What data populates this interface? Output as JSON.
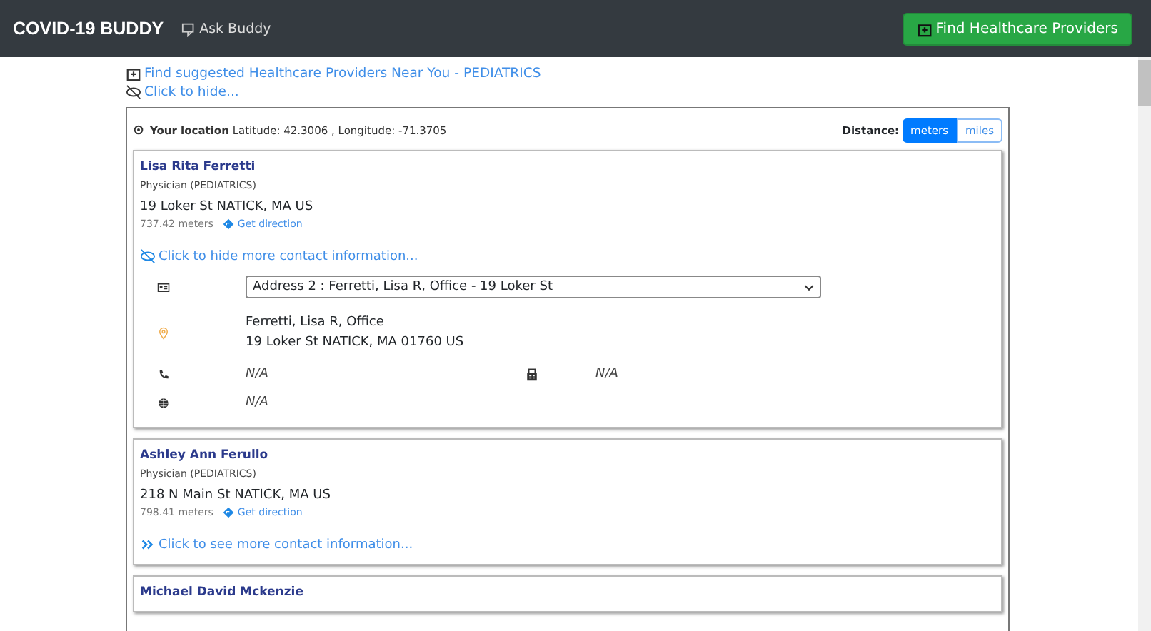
{
  "navbar": {
    "brand": "COVID-19 BUDDY",
    "link": "Ask Buddy",
    "button": "Find Healthcare Providers"
  },
  "heading": {
    "title": "Find suggested Healthcare Providers Near You - PEDIATRICS",
    "toggle": "Click to hide..."
  },
  "location": {
    "label": "Your location",
    "coords": "Latitude: 42.3006 , Longitude: -71.3705"
  },
  "distance": {
    "label": "Distance:",
    "options": [
      {
        "label": "meters",
        "selected": true
      },
      {
        "label": "miles",
        "selected": false
      }
    ]
  },
  "providers": [
    {
      "name": "Lisa Rita Ferretti",
      "role": "Physician (PEDIATRICS)",
      "address": "19 Loker St NATICK, MA US",
      "distance": "737.42 meters",
      "direction": "Get direction",
      "expanded": true,
      "toggle": "Click to hide more contact information...",
      "details": {
        "address_select": "Address 2 : Ferretti, Lisa R, Office - 19 Loker St",
        "office": "Ferretti, Lisa R, Office",
        "full_address": "19 Loker St NATICK, MA 01760 US",
        "phone": "N/A",
        "fax": "N/A",
        "website": "N/A"
      }
    },
    {
      "name": "Ashley Ann Ferullo",
      "role": "Physician (PEDIATRICS)",
      "address": "218 N Main St NATICK, MA US",
      "distance": "798.41 meters",
      "direction": "Get direction",
      "expanded": false,
      "toggle": "Click to see more contact information..."
    },
    {
      "name": "Michael David Mckenzie"
    }
  ]
}
